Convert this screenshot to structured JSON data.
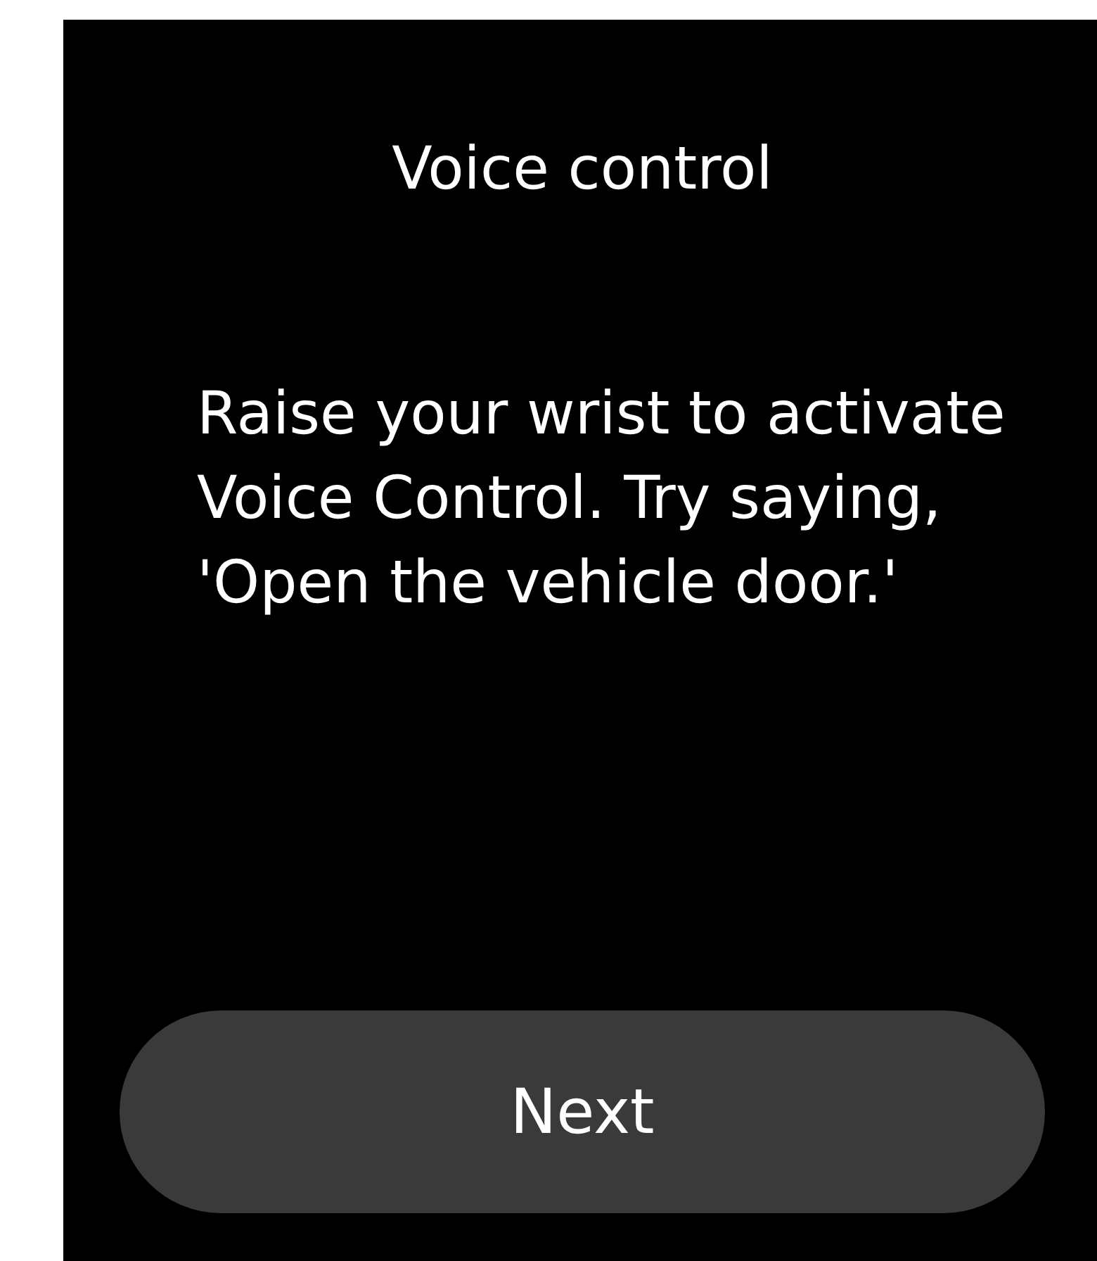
{
  "title": "Voice control",
  "message": "Raise your wrist to activate Voice Control. Try saying, 'Open the vehicle door.'",
  "button": {
    "label": "Next"
  }
}
